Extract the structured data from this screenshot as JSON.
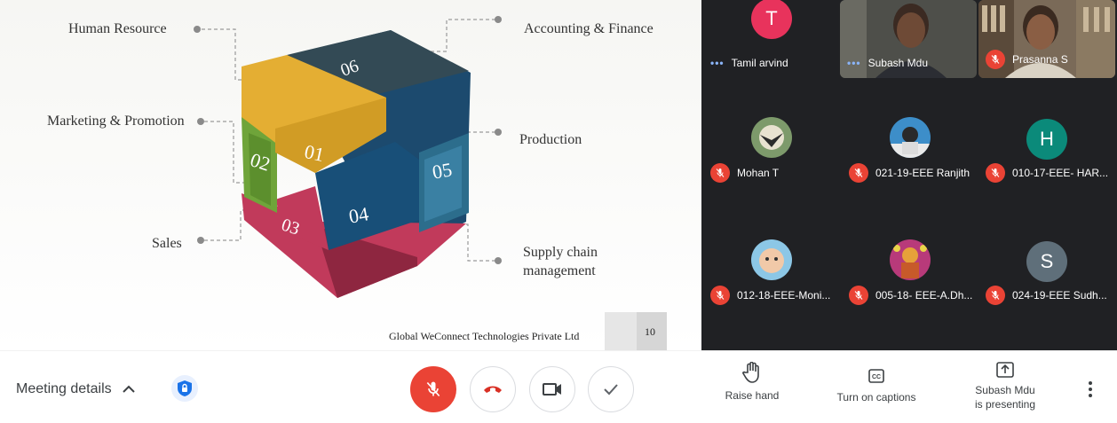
{
  "slide": {
    "labels": {
      "human_resource": "Human Resource",
      "accounting_finance": "Accounting & Finance",
      "marketing_promotion": "Marketing & Promotion",
      "production": "Production",
      "sales": "Sales",
      "supply_chain_1": "Supply chain",
      "supply_chain_2": "management"
    },
    "cube_numbers": {
      "n01": "01",
      "n02": "02",
      "n03": "03",
      "n04": "04",
      "n05": "05",
      "n06": "06"
    },
    "footer": "Global WeConnect Technologies Private Ltd",
    "page_number": "10",
    "colors": {
      "yellow": "#e4ae33",
      "green": "#6fa43a",
      "crimson": "#c13a5b",
      "navy": "#1c4a6e",
      "teal": "#2c6d8c",
      "slate": "#334a55"
    }
  },
  "participants": [
    {
      "name": "Tamil arvind",
      "avatar": "T",
      "avatar_color": "#e8335c",
      "status": "speaking"
    },
    {
      "name": "Subash Mdu",
      "avatar": "video",
      "status": "speaking"
    },
    {
      "name": "Prasanna S",
      "avatar": "video",
      "status": "muted"
    },
    {
      "name": "Mohan T",
      "avatar": "photo",
      "status": "muted"
    },
    {
      "name": "021-19-EEE Ranjith",
      "avatar": "photo",
      "status": "muted"
    },
    {
      "name": "010-17-EEE- HAR...",
      "avatar": "H",
      "avatar_color": "#0b8a7a",
      "status": "muted"
    },
    {
      "name": "012-18-EEE-Moni...",
      "avatar": "photo",
      "status": "muted"
    },
    {
      "name": "005-18- EEE-A.Dh...",
      "avatar": "photo",
      "status": "muted"
    },
    {
      "name": "024-19-EEE Sudh...",
      "avatar": "S",
      "avatar_color": "#5f6f7a",
      "status": "muted"
    }
  ],
  "bottombar": {
    "meeting_details": "Meeting details",
    "raise_hand": "Raise hand",
    "captions": "Turn on captions",
    "presenting_1": "Subash Mdu",
    "presenting_2": "is presenting",
    "icons": [
      "shield-lock-icon",
      "mic-off-icon",
      "hang-up-icon",
      "camera-icon",
      "check-icon",
      "hand-icon",
      "cc-icon",
      "present-icon",
      "more-vert-icon"
    ]
  }
}
